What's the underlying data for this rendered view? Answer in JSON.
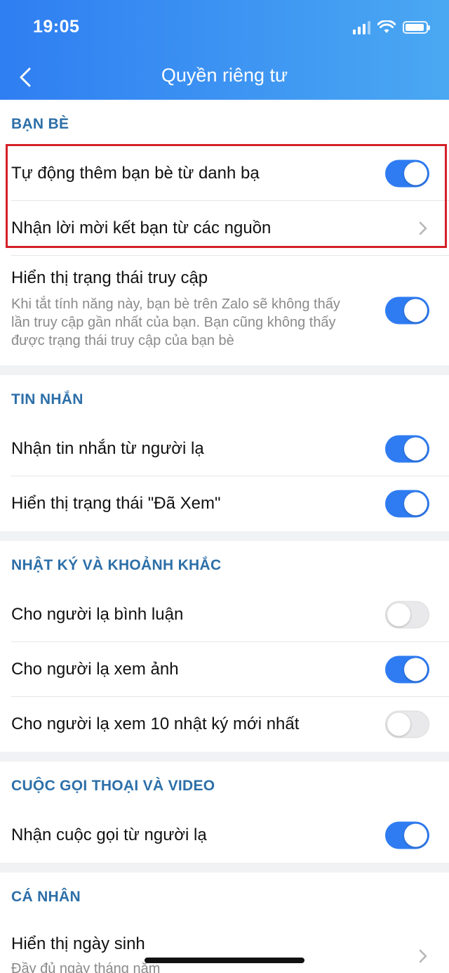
{
  "status_bar": {
    "time": "19:05"
  },
  "nav": {
    "title": "Quyền riêng tư",
    "back_icon": "chevron-left-icon"
  },
  "colors": {
    "accent": "#2f7cf2",
    "section_title": "#2d6fa8",
    "highlight": "#d42027"
  },
  "sections": {
    "friends": {
      "title": "BẠN BÈ",
      "items": [
        {
          "label": "Tự động thêm bạn bè từ danh bạ",
          "toggle": true
        },
        {
          "label": "Nhận lời mời kết bạn từ các nguồn"
        },
        {
          "label": "Hiển thị trạng thái truy cập",
          "description": "Khi tắt tính năng này, bạn bè trên Zalo sẽ không thấy lần truy cập gần nhất của bạn. Bạn cũng không thấy được trạng thái truy cập của bạn bè",
          "toggle": true
        }
      ]
    },
    "messages": {
      "title": "TIN NHẮN",
      "items": [
        {
          "label": "Nhận tin nhắn từ người lạ",
          "toggle": true
        },
        {
          "label": "Hiển thị trạng thái \"Đã Xem\"",
          "toggle": true
        }
      ]
    },
    "diary": {
      "title": "NHẬT KÝ VÀ KHOẢNH KHẮC",
      "items": [
        {
          "label": "Cho người lạ bình luận",
          "toggle": false
        },
        {
          "label": "Cho người lạ xem ảnh",
          "toggle": true
        },
        {
          "label": "Cho người lạ xem 10 nhật ký mới nhất",
          "toggle": false
        }
      ]
    },
    "calls": {
      "title": "CUỘC GỌI THOẠI VÀ VIDEO",
      "items": [
        {
          "label": "Nhận cuộc gọi từ người lạ",
          "toggle": true
        }
      ]
    },
    "personal": {
      "title": "CÁ NHÂN",
      "items": [
        {
          "label": "Hiển thị ngày sinh",
          "description": "Đầy đủ ngày tháng năm"
        }
      ]
    }
  }
}
